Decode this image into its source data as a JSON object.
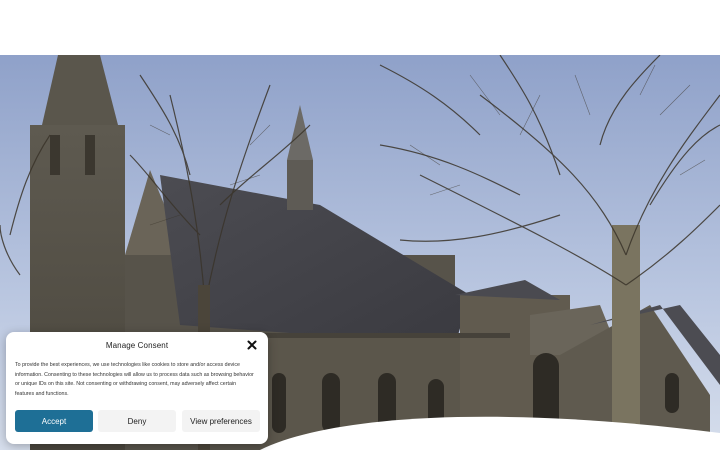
{
  "hero": {
    "image": "church-with-bare-trees-photo"
  },
  "consent": {
    "title": "Manage Consent",
    "body": "To provide the best experiences, we use technologies like cookies to store and/or access device information. Consenting to these technologies will allow us to process data such as browsing behavior or unique IDs on this site. Not consenting or withdrawing consent, may adversely affect certain features and functions.",
    "close_icon": "close-icon",
    "buttons": {
      "accept": "Accept",
      "deny": "Deny",
      "preferences": "View preferences"
    },
    "accent_color": "#1e6f96"
  }
}
